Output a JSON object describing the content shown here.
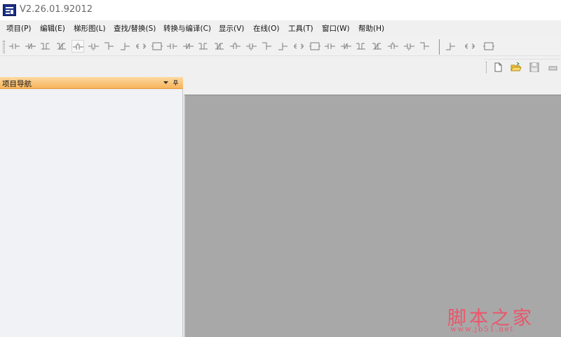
{
  "titlebar": {
    "version": "V2.26.01.92012",
    "logo_icon": "app-logo-icon"
  },
  "menu": {
    "items": [
      {
        "label": "项目(P)"
      },
      {
        "label": "编辑(E)"
      },
      {
        "label": "梯形图(L)"
      },
      {
        "label": "查找/替换(S)"
      },
      {
        "label": "转换与编译(C)"
      },
      {
        "label": "显示(V)"
      },
      {
        "label": "在线(O)"
      },
      {
        "label": "工具(T)"
      },
      {
        "label": "窗口(W)"
      },
      {
        "label": "帮助(H)"
      }
    ]
  },
  "ladder_toolbar": {
    "buttons": [
      "normally-open-contact-icon",
      "normally-closed-contact-icon",
      "parallel-open-contact-icon",
      "parallel-closed-contact-icon",
      "rising-edge-contact-icon",
      "falling-edge-contact-icon",
      "parallel-rising-edge-icon",
      "parallel-falling-edge-icon",
      "coil-icon",
      "function-block-icon",
      "horizontal-line-icon",
      "vertical-line-icon",
      "delete-horizontal-line-icon",
      "delete-vertical-line-icon",
      "operation-result-rising-icon",
      "operation-result-falling-icon",
      "invert-result-icon",
      "line-input-icon",
      "line-delete-icon",
      "horizontal-wire-icon",
      "vertical-wire-icon",
      "contact-series-icon",
      "contact-parallel-icon",
      "branch-icon",
      "merge-icon",
      "output-coil-icon",
      "set-coil-icon",
      "reset-coil-icon",
      "instruction-icon",
      "comment-icon"
    ]
  },
  "file_toolbar": {
    "buttons": [
      "new-file-icon",
      "open-folder-icon",
      "save-icon",
      "print-icon"
    ]
  },
  "nav_panel": {
    "title": "项目导航",
    "dropdown_icon": "dropdown-arrow-icon",
    "pin_icon": "pin-icon"
  },
  "colors": {
    "nav_header": "#f6b45c",
    "workspace": "#a8a8a8",
    "watermark": "#e9566a"
  },
  "watermark": {
    "title": "脚本之家",
    "url": "www.jb51.net"
  }
}
